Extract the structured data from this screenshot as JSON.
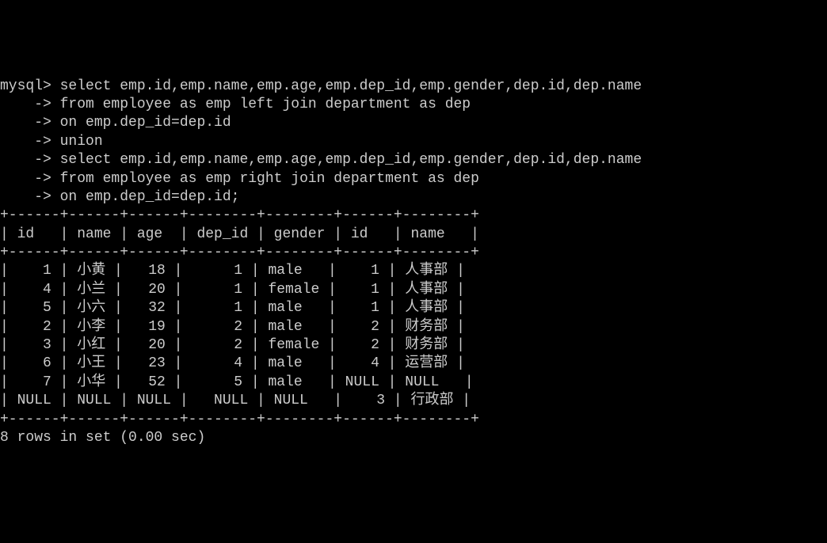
{
  "prompt": "mysql>",
  "continuation": "    ->",
  "query_lines": [
    " select emp.id,emp.name,emp.age,emp.dep_id,emp.gender,dep.id,dep.name",
    " from employee as emp left join department as dep",
    " on emp.dep_id=dep.id",
    " union",
    " select emp.id,emp.name,emp.age,emp.dep_id,emp.gender,dep.id,dep.name",
    " from employee as emp right join department as dep",
    " on emp.dep_id=dep.id;"
  ],
  "table": {
    "border_top": "+------+------+------+--------+--------+------+--------+",
    "border_mid": "+------+------+------+--------+--------+------+--------+",
    "border_bottom": "+------+------+------+--------+--------+------+--------+",
    "header_row": "| id   | name | age  | dep_id | gender | id   | name   |",
    "headers": [
      "id",
      "name",
      "age",
      "dep_id",
      "gender",
      "id",
      "name"
    ],
    "rows": [
      {
        "id": "1",
        "name": "小黄",
        "age": "18",
        "dep_id": "1",
        "gender": "male",
        "dep_id2": "1",
        "dep_name": "人事部"
      },
      {
        "id": "4",
        "name": "小兰",
        "age": "20",
        "dep_id": "1",
        "gender": "female",
        "dep_id2": "1",
        "dep_name": "人事部"
      },
      {
        "id": "5",
        "name": "小六",
        "age": "32",
        "dep_id": "1",
        "gender": "male",
        "dep_id2": "1",
        "dep_name": "人事部"
      },
      {
        "id": "2",
        "name": "小李",
        "age": "19",
        "dep_id": "2",
        "gender": "male",
        "dep_id2": "2",
        "dep_name": "财务部"
      },
      {
        "id": "3",
        "name": "小红",
        "age": "20",
        "dep_id": "2",
        "gender": "female",
        "dep_id2": "2",
        "dep_name": "财务部"
      },
      {
        "id": "6",
        "name": "小王",
        "age": "23",
        "dep_id": "4",
        "gender": "male",
        "dep_id2": "4",
        "dep_name": "运营部"
      },
      {
        "id": "7",
        "name": "小华",
        "age": "52",
        "dep_id": "5",
        "gender": "male",
        "dep_id2": "NULL",
        "dep_name": "NULL"
      },
      {
        "id": "NULL",
        "name": "NULL",
        "age": "NULL",
        "dep_id": "NULL",
        "gender": "NULL",
        "dep_id2": "3",
        "dep_name": "行政部"
      }
    ],
    "data_rows_formatted": [
      "|    1 | 小黄 |   18 |      1 | male   |    1 | 人事部 |",
      "|    4 | 小兰 |   20 |      1 | female |    1 | 人事部 |",
      "|    5 | 小六 |   32 |      1 | male   |    1 | 人事部 |",
      "|    2 | 小李 |   19 |      2 | male   |    2 | 财务部 |",
      "|    3 | 小红 |   20 |      2 | female |    2 | 财务部 |",
      "|    6 | 小王 |   23 |      4 | male   |    4 | 运营部 |",
      "|    7 | 小华 |   52 |      5 | male   | NULL | NULL   |",
      "| NULL | NULL | NULL |   NULL | NULL   |    3 | 行政部 |"
    ]
  },
  "result_status": "8 rows in set (0.00 sec)"
}
